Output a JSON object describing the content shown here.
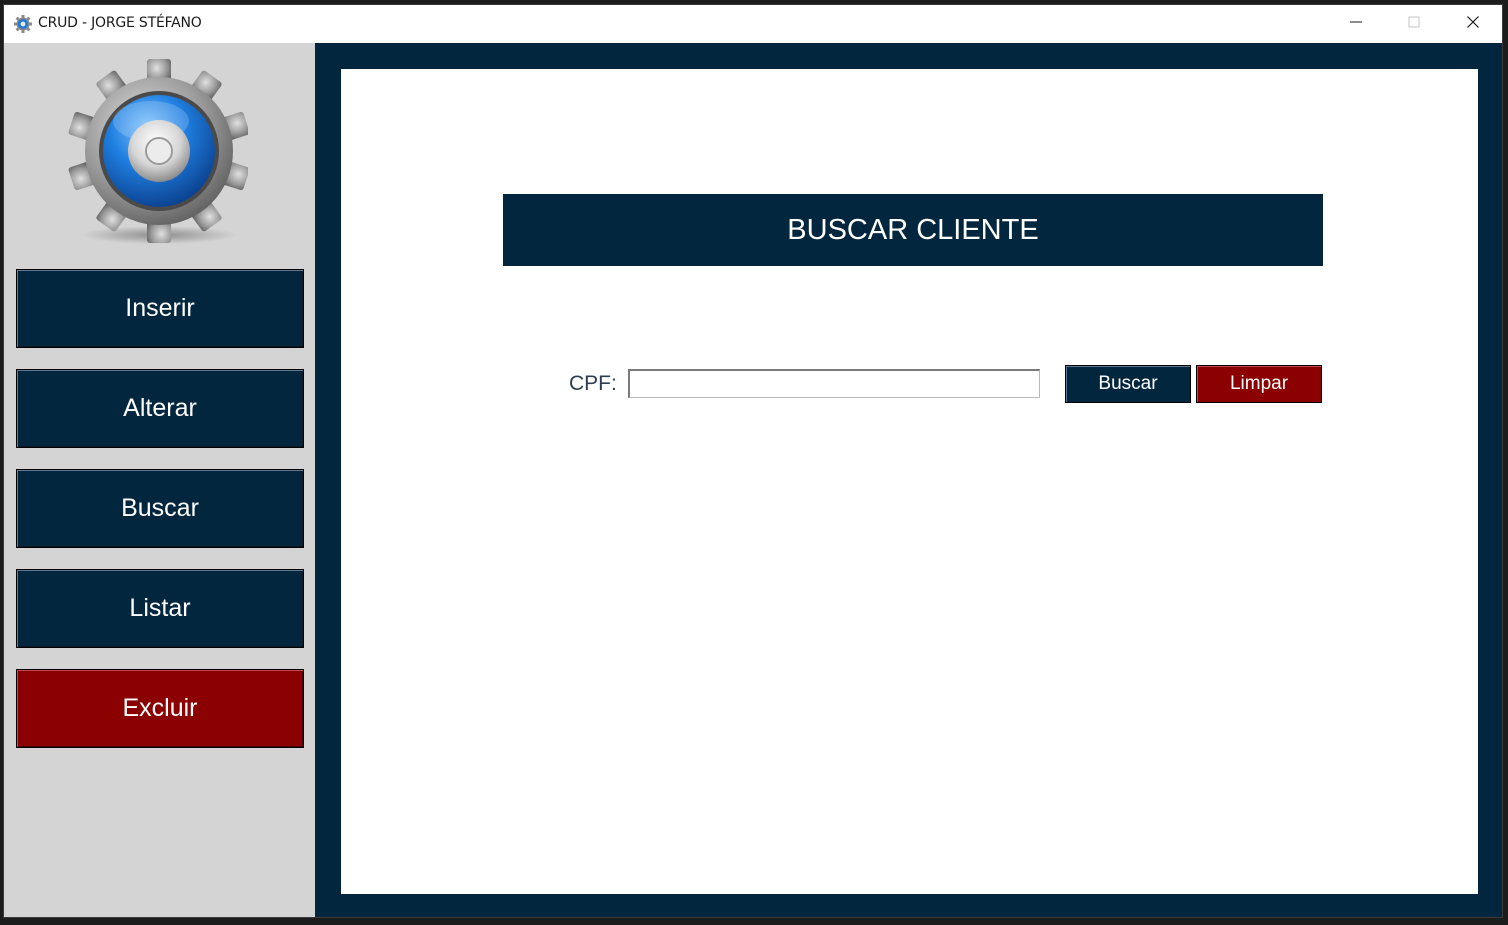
{
  "window": {
    "title": "CRUD - JORGE STÉFANO",
    "icon": "gear-app-icon"
  },
  "titlebar_controls": {
    "minimize_icon": "minimize-icon",
    "maximize_icon": "maximize-icon",
    "close_icon": "close-icon"
  },
  "sidebar": {
    "logo_icon": "gear-logo-icon",
    "buttons": [
      {
        "label": "Inserir",
        "color": "#03263f"
      },
      {
        "label": "Alterar",
        "color": "#03263f"
      },
      {
        "label": "Buscar",
        "color": "#03263f"
      },
      {
        "label": "Listar",
        "color": "#03263f"
      },
      {
        "label": "Excluir",
        "color": "#8b0000"
      }
    ]
  },
  "main": {
    "heading": "BUSCAR CLIENTE",
    "cpf_label": "CPF:",
    "cpf_value": "",
    "search_button": "Buscar",
    "clear_button": "Limpar"
  },
  "colors": {
    "navy": "#03263f",
    "danger": "#8b0000",
    "sidebar_bg": "#d4d4d4"
  }
}
